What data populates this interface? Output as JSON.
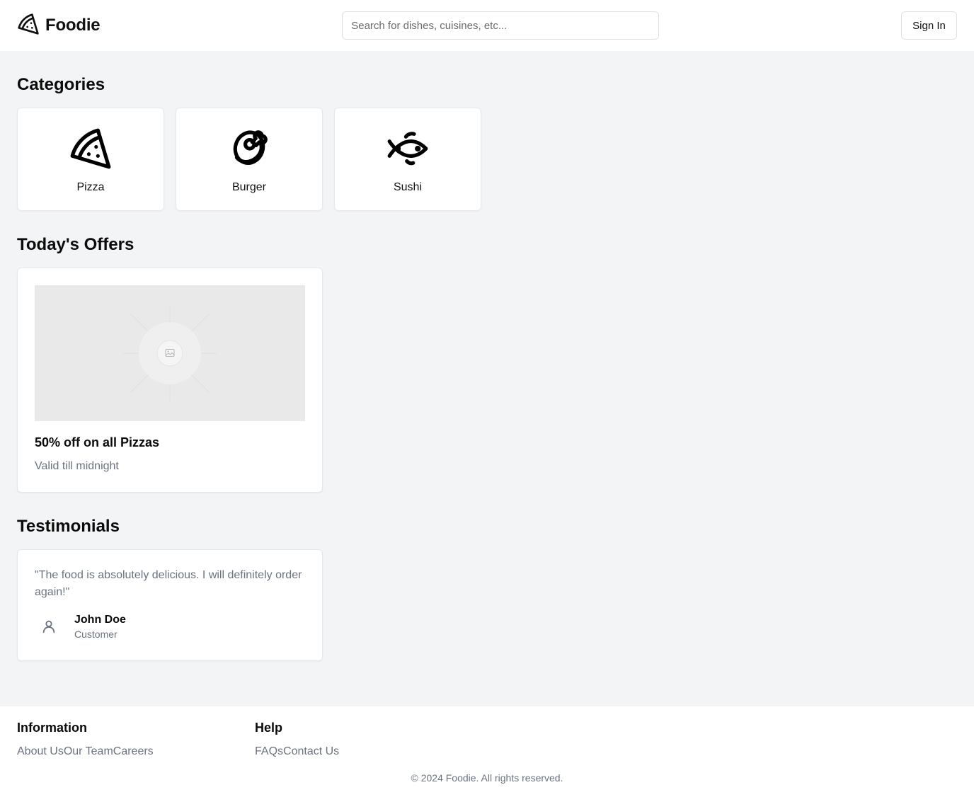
{
  "header": {
    "brand_name": "Foodie",
    "search_placeholder": "Search for dishes, cuisines, etc...",
    "signin_label": "Sign In"
  },
  "categories": {
    "title": "Categories",
    "items": [
      {
        "label": "Pizza",
        "icon": "pizza-icon"
      },
      {
        "label": "Burger",
        "icon": "meat-icon"
      },
      {
        "label": "Sushi",
        "icon": "fish-icon"
      }
    ]
  },
  "offers": {
    "title": "Today's Offers",
    "items": [
      {
        "title": "50% off on all Pizzas",
        "subtitle": "Valid till midnight",
        "image": "image-placeholder-icon"
      }
    ]
  },
  "testimonials": {
    "title": "Testimonials",
    "items": [
      {
        "quote": "\"The food is absolutely delicious. I will definitely order again!\"",
        "name": "John Doe",
        "role": "Customer",
        "avatar": "user-icon"
      }
    ]
  },
  "footer": {
    "information": {
      "title": "Information",
      "links": [
        "About Us",
        "Our Team",
        "Careers"
      ]
    },
    "help": {
      "title": "Help",
      "links": [
        "FAQs",
        "Contact Us"
      ]
    },
    "copyright": "© 2024 Foodie. All rights reserved."
  },
  "colors": {
    "page_bg": "#f3f4f6",
    "card_bg": "#ffffff",
    "muted_text": "#6b7280",
    "image_placeholder": "#e9e9e9"
  }
}
